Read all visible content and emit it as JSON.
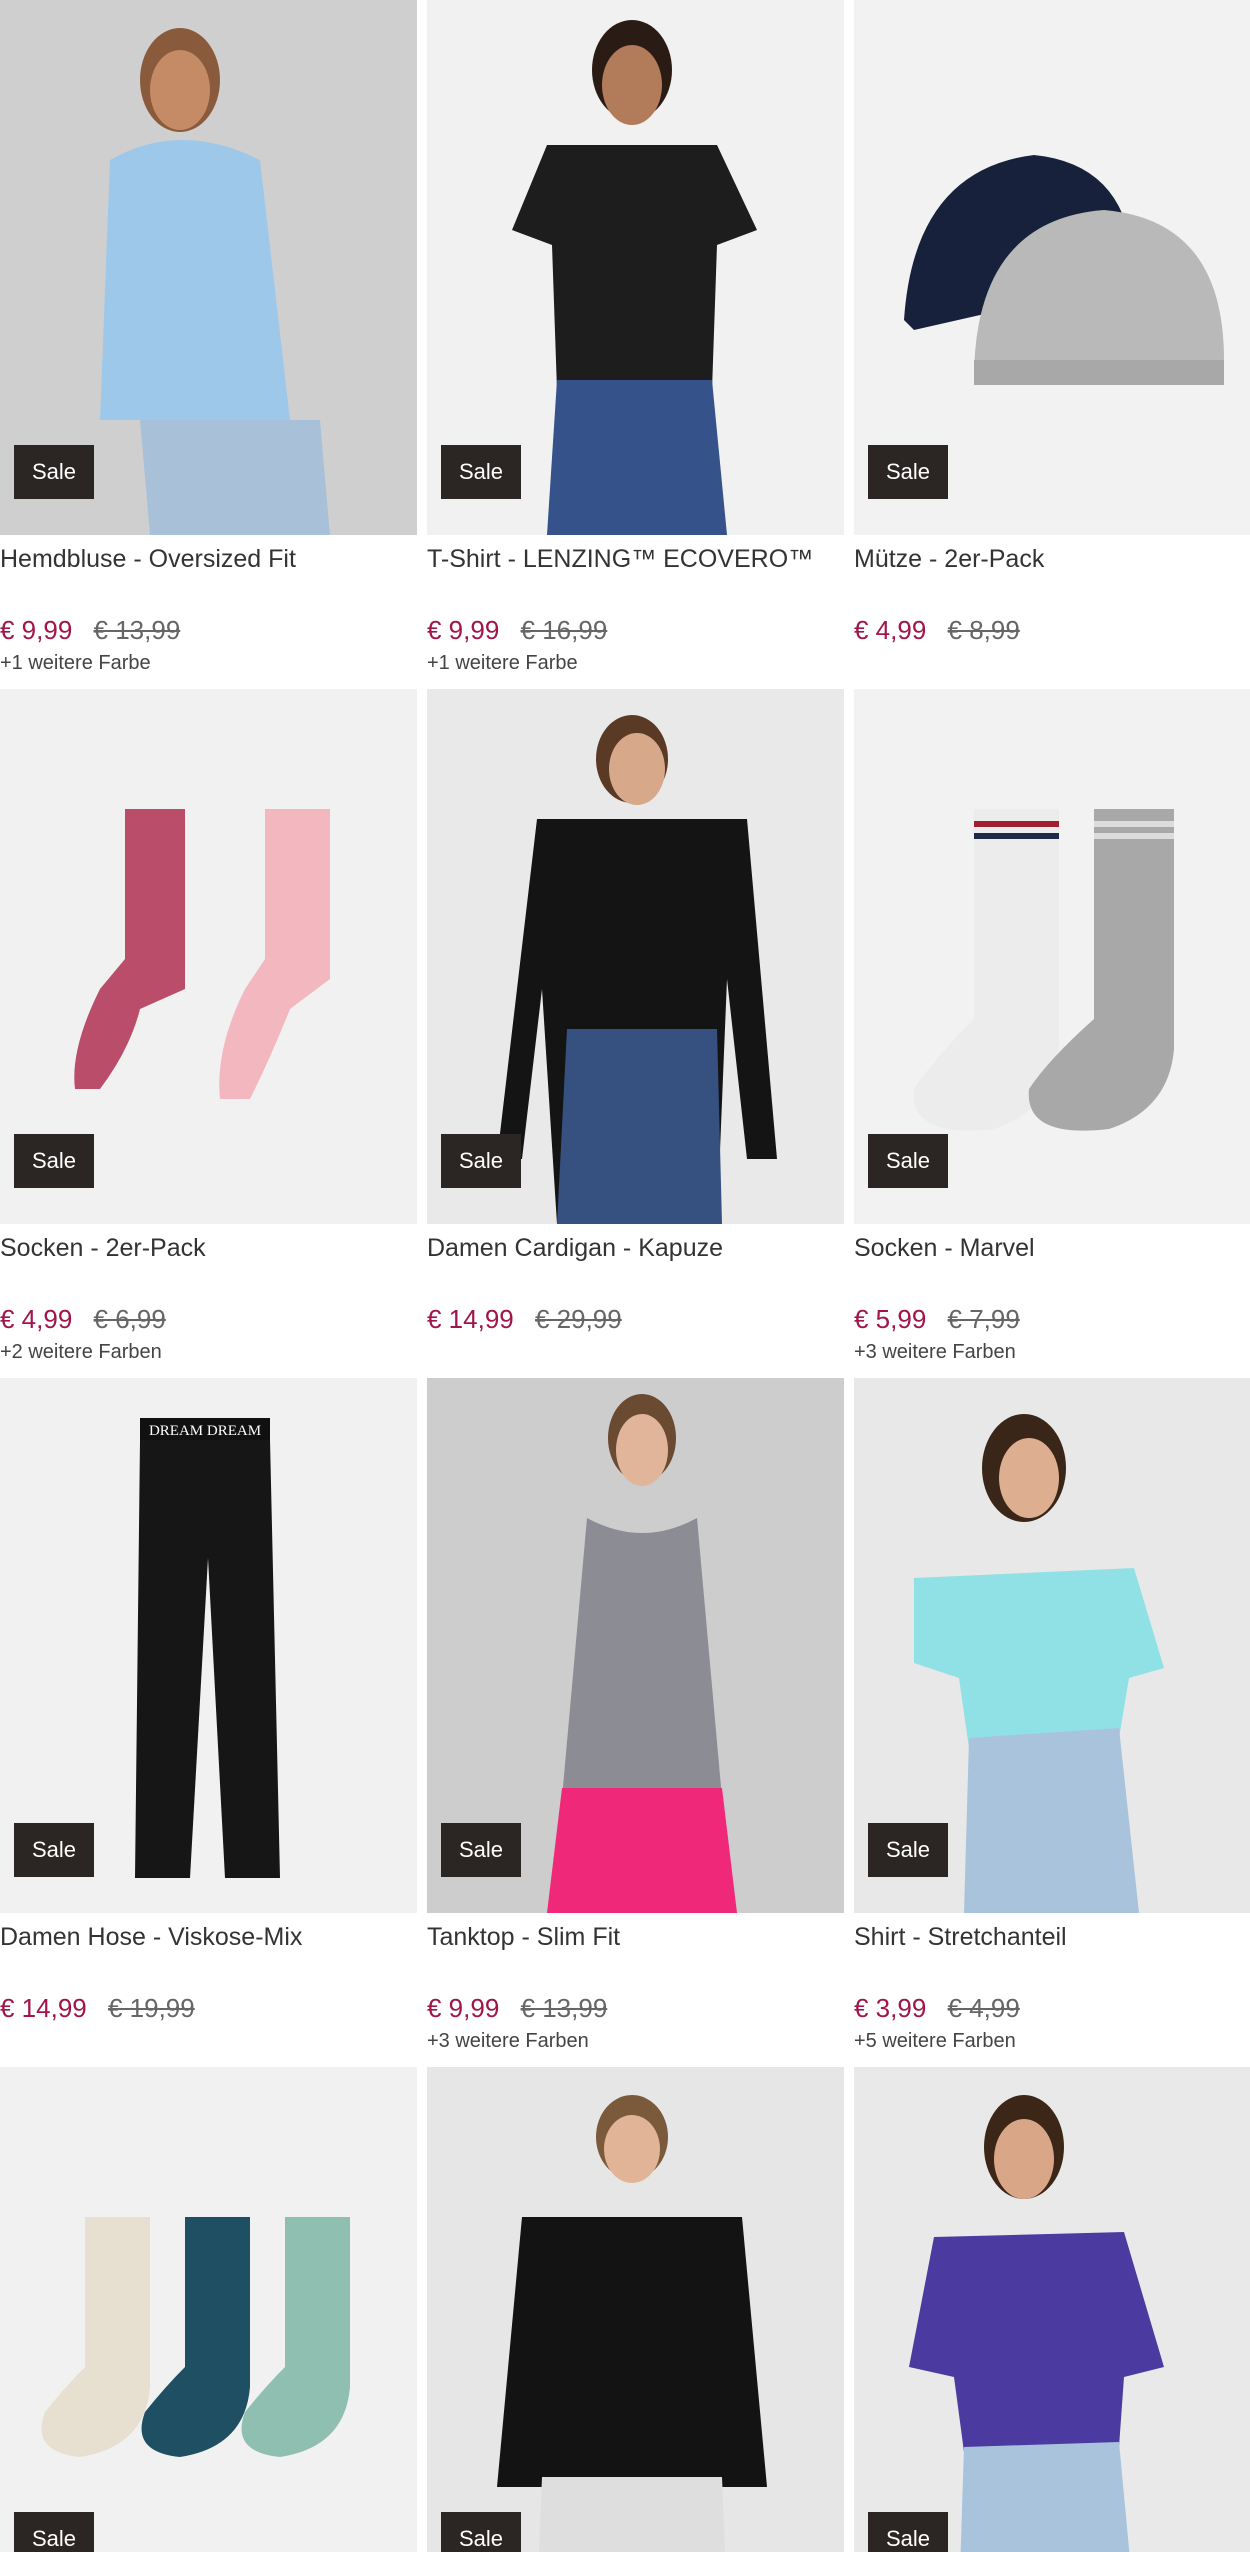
{
  "badge": "Sale",
  "colors": {
    "sale_price": "#a1154a",
    "badge_bg": "#2b2523"
  },
  "products": [
    {
      "title": "Hemdbluse - Oversized Fit",
      "price": "€ 9,99",
      "old_price": "€ 13,99",
      "colors_note": "+1 weitere Farbe",
      "icon": "blouse-image"
    },
    {
      "title": "T-Shirt - LENZING™ ECOVERO™",
      "price": "€ 9,99",
      "old_price": "€ 16,99",
      "colors_note": "+1 weitere Farbe",
      "icon": "tshirt-image"
    },
    {
      "title": "Mütze - 2er-Pack",
      "price": "€ 4,99",
      "old_price": "€ 8,99",
      "colors_note": "",
      "icon": "beanie-image"
    },
    {
      "title": "Socken - 2er-Pack",
      "price": "€ 4,99",
      "old_price": "€ 6,99",
      "colors_note": "+2 weitere Farben",
      "icon": "tights-image"
    },
    {
      "title": "Damen Cardigan - Kapuze",
      "price": "€ 14,99",
      "old_price": "€ 29,99",
      "colors_note": "",
      "icon": "cardigan-image"
    },
    {
      "title": "Socken - Marvel",
      "price": "€ 5,99",
      "old_price": "€ 7,99",
      "colors_note": "+3 weitere Farben",
      "icon": "socks-image"
    },
    {
      "title": "Damen Hose - Viskose-Mix",
      "price": "€ 14,99",
      "old_price": "€ 19,99",
      "colors_note": "",
      "icon": "trousers-image",
      "waistband_text": "DREAM DREAM"
    },
    {
      "title": "Tanktop - Slim Fit",
      "price": "€ 9,99",
      "old_price": "€ 13,99",
      "colors_note": "+3 weitere Farben",
      "icon": "tanktop-image"
    },
    {
      "title": "Shirt - Stretchanteil",
      "price": "€ 3,99",
      "old_price": "€ 4,99",
      "colors_note": "+5 weitere Farben",
      "icon": "shirt-image"
    },
    {
      "title": "",
      "price": "",
      "old_price": "",
      "colors_note": "",
      "icon": "socks-3pack-image"
    },
    {
      "title": "",
      "price": "",
      "old_price": "",
      "colors_note": "",
      "icon": "jacket-image"
    },
    {
      "title": "",
      "price": "",
      "old_price": "",
      "colors_note": "",
      "icon": "floral-blouse-image"
    }
  ]
}
